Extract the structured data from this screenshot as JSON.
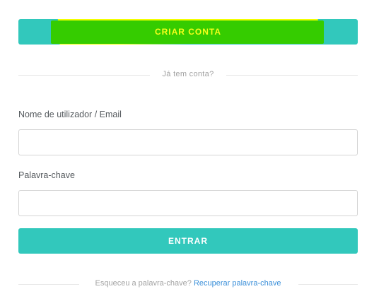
{
  "create_account": {
    "label": "CRIAR CONTA"
  },
  "divider_top": {
    "text": "Já tem conta?"
  },
  "username": {
    "label": "Nome de utilizador / Email",
    "value": "",
    "placeholder": ""
  },
  "password": {
    "label": "Palavra-chave",
    "value": "",
    "placeholder": ""
  },
  "login": {
    "label": "ENTRAR"
  },
  "forgot": {
    "text": "Esqueceu a palavra-chave?",
    "link_label": "Recuperar palavra-chave"
  },
  "colors": {
    "accent": "#32c8bc",
    "highlight_yellow": "#f2ff00",
    "highlight_green": "#35cc00",
    "link": "#3a8fd9"
  }
}
